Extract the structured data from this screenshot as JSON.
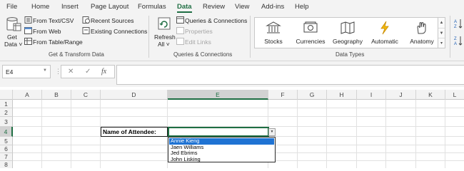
{
  "tabs": [
    {
      "label": "File"
    },
    {
      "label": "Home"
    },
    {
      "label": "Insert"
    },
    {
      "label": "Page Layout"
    },
    {
      "label": "Formulas"
    },
    {
      "label": "Data"
    },
    {
      "label": "Review"
    },
    {
      "label": "View"
    },
    {
      "label": "Add-ins"
    },
    {
      "label": "Help"
    }
  ],
  "active_tab": "Data",
  "ribbon": {
    "get_transform": {
      "get_data_line1": "Get",
      "get_data_line2": "Data ˅",
      "from_text_csv": "From Text/CSV",
      "from_web": "From Web",
      "from_table_range": "From Table/Range",
      "recent_sources": "Recent Sources",
      "existing_connections": "Existing Connections",
      "group_label": "Get & Transform Data"
    },
    "queries": {
      "refresh_line1": "Refresh",
      "refresh_line2": "All ˅",
      "queries_connections": "Queries & Connections",
      "properties": "Properties",
      "edit_links": "Edit Links",
      "group_label": "Queries & Connections"
    },
    "data_types": {
      "items": [
        {
          "label": "Stocks",
          "icon": "bank-icon"
        },
        {
          "label": "Currencies",
          "icon": "currency-icon"
        },
        {
          "label": "Geography",
          "icon": "map-icon"
        },
        {
          "label": "Automatic",
          "icon": "lightning-icon"
        },
        {
          "label": "Anatomy",
          "icon": "hand-icon"
        }
      ],
      "group_label": "Data Types"
    }
  },
  "formula_bar": {
    "name_box": "E4",
    "cancel": "✕",
    "enter": "✓",
    "fx": "fx",
    "formula": ""
  },
  "grid": {
    "columns": [
      "A",
      "B",
      "C",
      "D",
      "E",
      "F",
      "G",
      "H",
      "I",
      "J",
      "K",
      "L"
    ],
    "rows": [
      "1",
      "2",
      "3",
      "4",
      "5",
      "6",
      "7",
      "8"
    ],
    "selected_column": "E",
    "selected_row": "4",
    "label_cell": "Name of Attendee:",
    "dropdown_options": [
      "Annie Kieng",
      "Jaen Williams",
      "Jed Ebrims",
      "John Lisking"
    ],
    "highlighted_option": "Annie Kieng"
  },
  "colors": {
    "accent": "#1f6e43",
    "highlight": "#1f73d3"
  }
}
